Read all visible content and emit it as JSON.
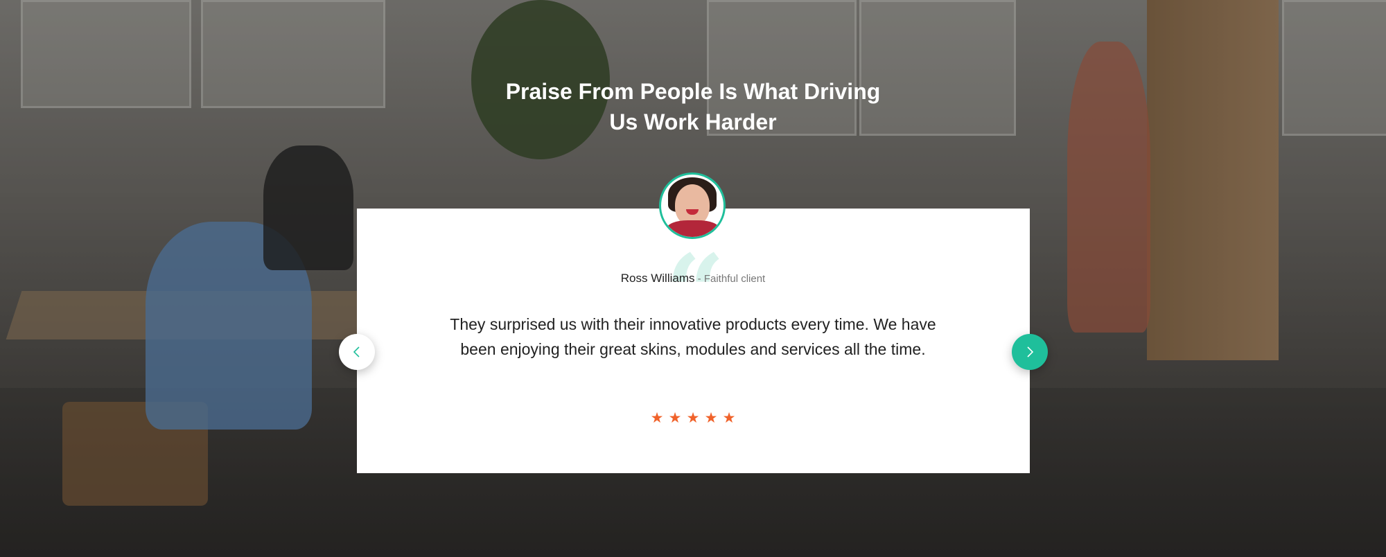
{
  "section": {
    "title_line1": "Praise From People Is What Driving",
    "title_line2": "Us Work Harder"
  },
  "testimonial": {
    "author_name": "Ross Williams",
    "separator": " - ",
    "author_role": "Faithful client",
    "quote_mark": "“",
    "text": "They surprised us with their innovative products every time. We have been enjoying their great skins, modules and services all the time.",
    "rating": 5,
    "star_glyph": "★"
  },
  "navigation": {
    "prev_icon": "chevron-left-icon",
    "next_icon": "chevron-right-icon"
  },
  "colors": {
    "accent": "#1fbf9b",
    "star": "#f0622a",
    "quote_mark": "#d8f3ec"
  }
}
